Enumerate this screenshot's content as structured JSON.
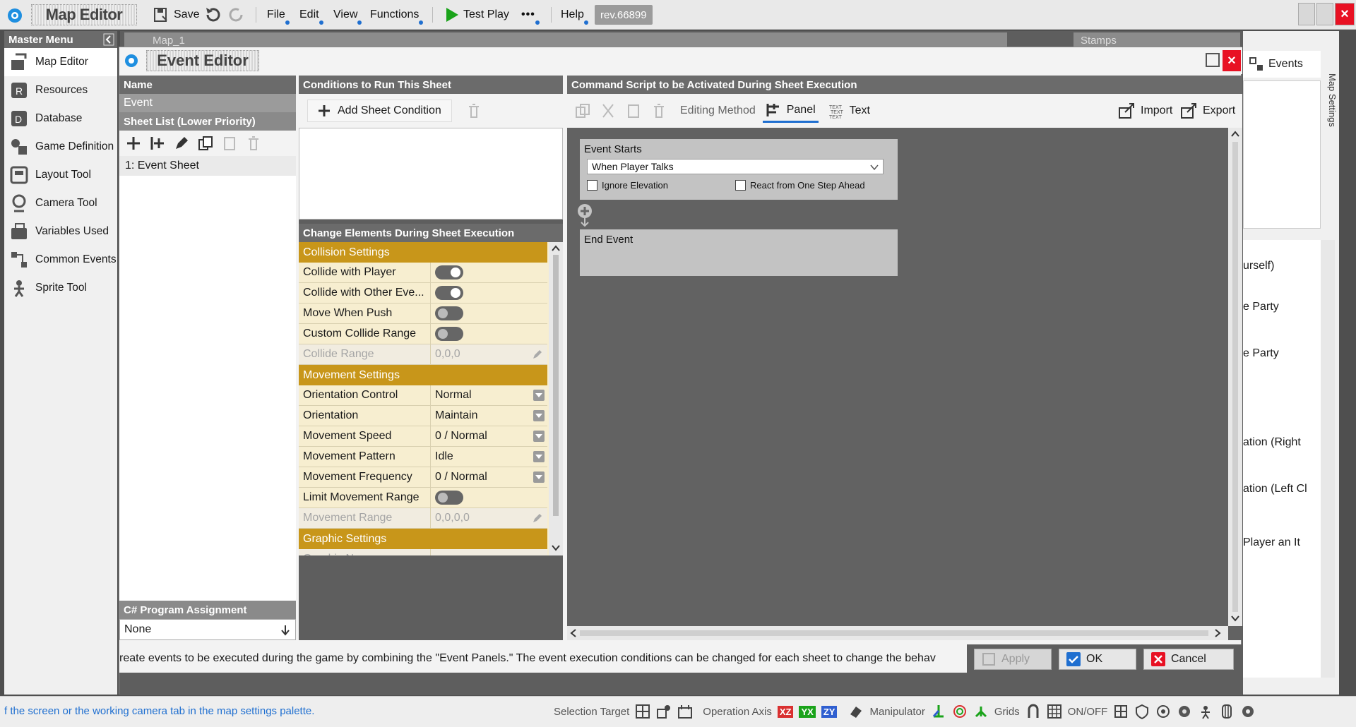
{
  "topbar": {
    "app_title": "Map Editor",
    "save": "Save",
    "menus": [
      "File",
      "Edit",
      "View",
      "Functions"
    ],
    "test_play": "Test Play",
    "more": "•••",
    "help": "Help",
    "revision": "rev.66899"
  },
  "master_menu": {
    "title": "Master Menu",
    "items": [
      "Map Editor",
      "Resources",
      "Database",
      "Game Definition",
      "Layout Tool",
      "Camera Tool",
      "Variables Used",
      "Common Events",
      "Sprite Tool"
    ]
  },
  "map_tab": {
    "label": "Map_1"
  },
  "stamps_tab": {
    "label": "Stamps"
  },
  "event_editor": {
    "title": "Event Editor",
    "left": {
      "name_header": "Name",
      "name_value": "Event",
      "sheet_list_header": "Sheet List (Lower Priority)",
      "sheets": [
        "1: Event Sheet"
      ],
      "csharp_header": "C# Program Assignment",
      "csharp_value": "None"
    },
    "conditions": {
      "header": "Conditions to Run This Sheet",
      "add_button": "Add Sheet Condition"
    },
    "change_elements": {
      "header": "Change Elements During Sheet Execution",
      "collision_section": "Collision Settings",
      "collide_with_player": "Collide with Player",
      "collide_with_other": "Collide with Other Eve...",
      "move_when_push": "Move When Push",
      "custom_collide_range": "Custom Collide Range",
      "collide_range": "Collide Range",
      "collide_range_value": "0,0,0",
      "movement_section": "Movement Settings",
      "orientation_control": "Orientation Control",
      "orientation_control_value": "Normal",
      "orientation": "Orientation",
      "orientation_value": "Maintain",
      "movement_speed": "Movement Speed",
      "movement_speed_value": "0 / Normal",
      "movement_pattern": "Movement Pattern",
      "movement_pattern_value": "Idle",
      "movement_frequency": "Movement Frequency",
      "movement_frequency_value": "0 / Normal",
      "limit_movement_range": "Limit Movement Range",
      "movement_range": "Movement Range",
      "movement_range_value": "0,0,0,0",
      "graphic_section": "Graphic Settings",
      "graphic_name": "Graphic Name"
    },
    "command_script": {
      "header": "Command Script to be Activated During Sheet Execution",
      "editing_method": "Editing Method",
      "panel": "Panel",
      "text": "Text",
      "import": "Import",
      "export": "Export",
      "event_starts_label": "Event Starts",
      "event_starts_value": "When Player Talks",
      "ignore_elevation": "Ignore Elevation",
      "react_one_step": "React from One Step Ahead",
      "end_event": "End Event"
    },
    "hint": "reate events to be executed during the game by combining the \"Event Panels.\"  The event execution conditions can be changed for each sheet to change the behav",
    "apply": "Apply",
    "ok": "OK",
    "cancel": "Cancel"
  },
  "right_panel": {
    "events_tab": "Events",
    "map_settings": "Map Settings",
    "items": [
      "urself)",
      "e Party",
      "e Party",
      "ation (Right",
      "ation (Left Cl",
      "Player an It"
    ]
  },
  "status": {
    "message": "f the screen or the working camera tab in the map settings palette.",
    "selection_target": "Selection Target",
    "operation_axis": "Operation Axis",
    "axis_xz": "XZ",
    "axis_yx": "YX",
    "axis_zy": "ZY",
    "manipulator": "Manipulator",
    "grids": "Grids",
    "onoff": "ON/OFF"
  },
  "colors": {
    "section_gold": "#c8961a",
    "property_bg": "#f7eed0",
    "header_gray": "#6b6b6b",
    "accent_blue": "#1f6fd0",
    "close_red": "#e81123",
    "play_green": "#1aa31a"
  }
}
